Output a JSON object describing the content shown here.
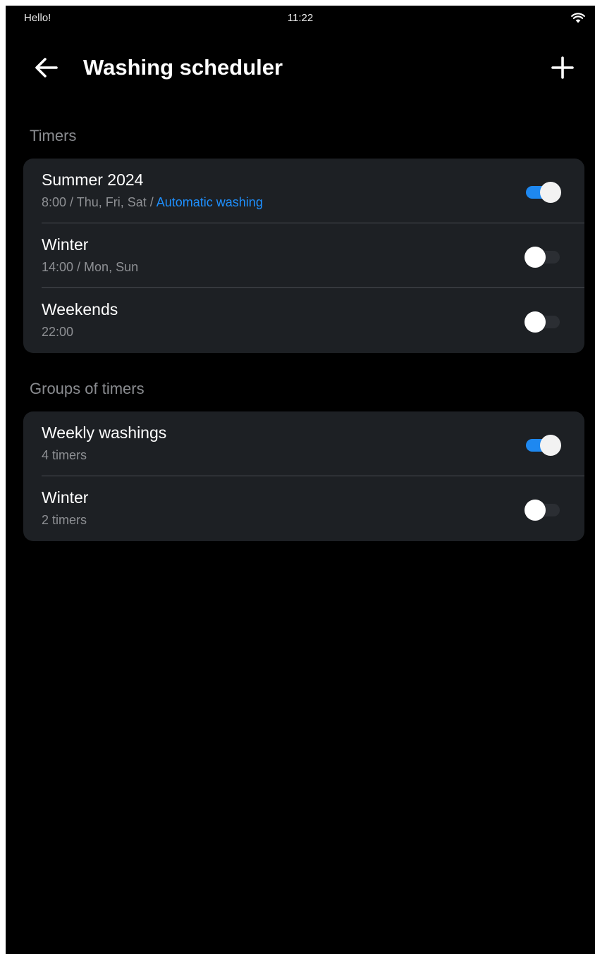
{
  "status_bar": {
    "left_text": "Hello!",
    "time": "11:22",
    "wifi_icon": "wifi-icon"
  },
  "app_bar": {
    "title": "Washing scheduler",
    "back_icon": "arrow-left-icon",
    "add_icon": "plus-icon"
  },
  "colors": {
    "background": "#000000",
    "card": "#1d2024",
    "accent": "#1e88f0",
    "link": "#1e90ff",
    "secondary_text": "#8e9094"
  },
  "sections": {
    "timers": {
      "title": "Timers",
      "items": [
        {
          "name": "Summer 2024",
          "sub": "8:00 / Thu, Fri, Sat / ",
          "sub_link": "Automatic washing",
          "enabled": true
        },
        {
          "name": "Winter",
          "sub": "14:00 / Mon, Sun",
          "enabled": false
        },
        {
          "name": "Weekends",
          "sub": "22:00",
          "enabled": false
        }
      ]
    },
    "groups": {
      "title": "Groups of timers",
      "items": [
        {
          "name": "Weekly washings",
          "sub": "4 timers",
          "enabled": true
        },
        {
          "name": "Winter",
          "sub": "2 timers",
          "enabled": false
        }
      ]
    }
  }
}
